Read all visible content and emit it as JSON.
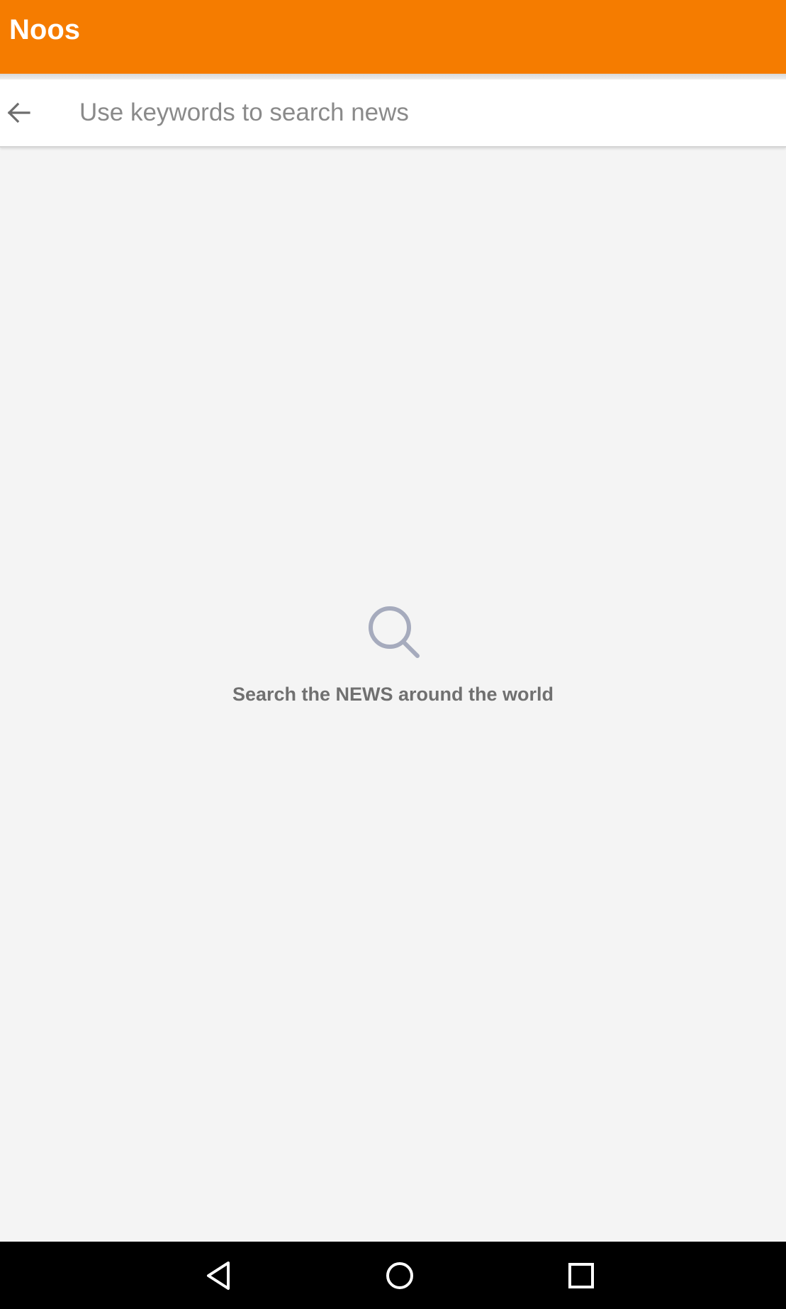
{
  "app_bar": {
    "title": "Noos",
    "color": "#f57c00"
  },
  "search": {
    "back_icon": "arrow-left-icon",
    "placeholder": "Use keywords to search news",
    "value": ""
  },
  "empty_state": {
    "icon": "search-icon",
    "message": "Search the NEWS around the world"
  },
  "nav_bar": {
    "buttons": [
      "back-triangle-icon",
      "home-circle-icon",
      "recents-square-icon"
    ]
  }
}
